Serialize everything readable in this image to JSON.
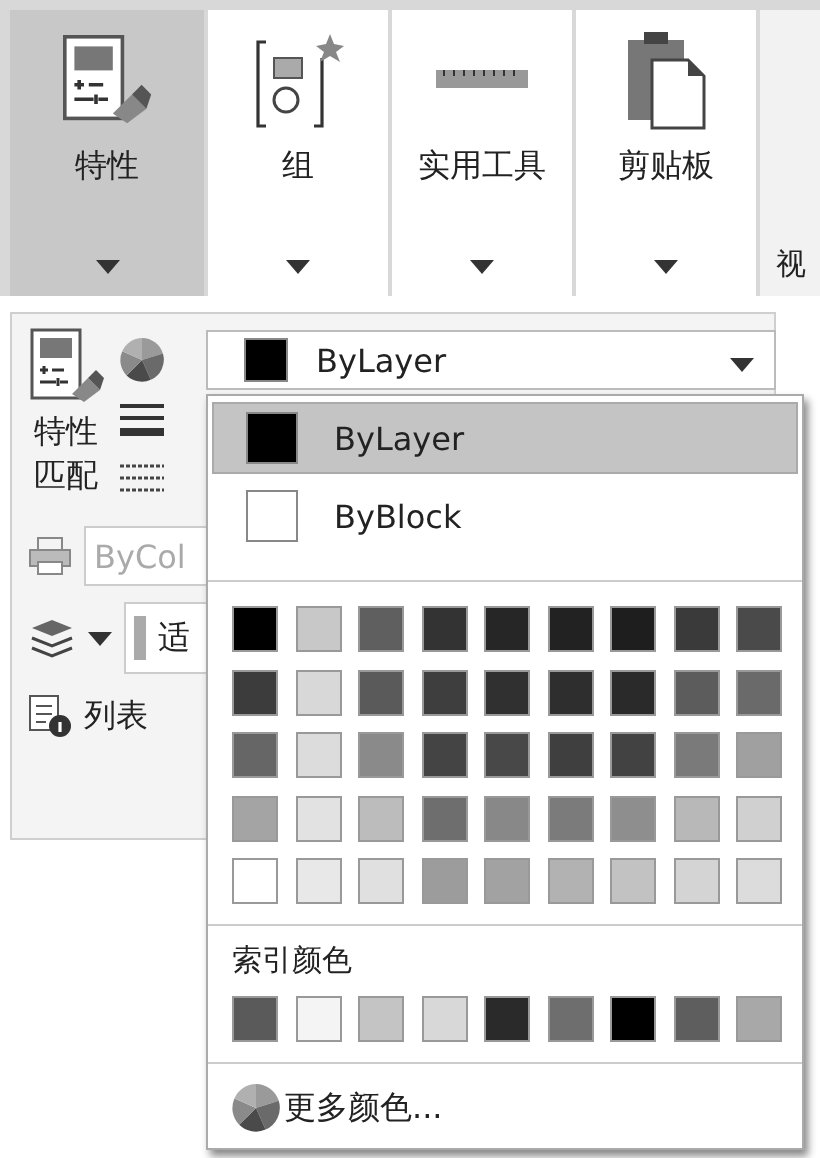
{
  "ribbon_panels": [
    {
      "label": "特性",
      "selected": true
    },
    {
      "label": "组",
      "selected": false
    },
    {
      "label": "实用工具",
      "selected": false
    },
    {
      "label": "剪贴板",
      "selected": false
    }
  ],
  "partial_panel_label": "视",
  "properties_panel": {
    "match_label": "特性匹配",
    "plot_style_field": "ByCol",
    "transparency_field": "适",
    "list_label": "列表"
  },
  "color_combo": {
    "value": "ByLayer",
    "color": "#000000"
  },
  "color_menu": {
    "options": [
      {
        "label": "ByLayer",
        "color": "#000000",
        "selected": true
      },
      {
        "label": "ByBlock",
        "color": "#ffffff",
        "selected": false
      }
    ],
    "swatches": [
      {
        "color": "#000000"
      },
      {
        "color": "#c8c8c8"
      },
      {
        "color": "#5f5f5f"
      },
      {
        "color": "#333333"
      },
      {
        "color": "#262626"
      },
      {
        "color": "#222222"
      },
      {
        "color": "#1e1e1e"
      },
      {
        "color": "#3a3a3a"
      },
      {
        "color": "#4a4a4a"
      },
      {
        "color": "#3c3c3c"
      },
      {
        "color": "#d8d8d8"
      },
      {
        "color": "#5a5a5a"
      },
      {
        "color": "#3e3e3e"
      },
      {
        "color": "#303030"
      },
      {
        "color": "#2e2e2e"
      },
      {
        "color": "#2a2a2a"
      },
      {
        "color": "#5c5c5c"
      },
      {
        "color": "#6a6a6a"
      },
      {
        "color": "#666666"
      },
      {
        "color": "#dcdcdc"
      },
      {
        "color": "#8a8a8a"
      },
      {
        "color": "#444444"
      },
      {
        "color": "#484848"
      },
      {
        "color": "#3f3f3f"
      },
      {
        "color": "#424242"
      },
      {
        "color": "#7a7a7a"
      },
      {
        "color": "#a0a0a0"
      },
      {
        "color": "#a4a4a4"
      },
      {
        "color": "#e2e2e2"
      },
      {
        "color": "#bcbcbc"
      },
      {
        "color": "#6e6e6e"
      },
      {
        "color": "#888888"
      },
      {
        "color": "#7b7b7b"
      },
      {
        "color": "#8e8e8e"
      },
      {
        "color": "#b8b8b8"
      },
      {
        "color": "#d0d0d0"
      },
      {
        "color": "#ffffff"
      },
      {
        "color": "#e8e8e8"
      },
      {
        "color": "#e0e0e0"
      },
      {
        "color": "#9c9c9c"
      },
      {
        "color": "#a2a2a2"
      },
      {
        "color": "#b2b2b2"
      },
      {
        "color": "#c2c2c2"
      },
      {
        "color": "#d4d4d4"
      },
      {
        "color": "#dcdcdd"
      }
    ],
    "index_heading": "索引颜色",
    "index_swatches": [
      {
        "color": "#5a5a5a"
      },
      {
        "color": "#f4f4f4"
      },
      {
        "color": "#c4c4c4"
      },
      {
        "color": "#d8d8d8"
      },
      {
        "color": "#2a2a2a"
      },
      {
        "color": "#6e6e6e"
      },
      {
        "color": "#000000"
      },
      {
        "color": "#5e5e5e"
      },
      {
        "color": "#a8a8a8"
      }
    ],
    "more_colors": "更多颜色..."
  }
}
